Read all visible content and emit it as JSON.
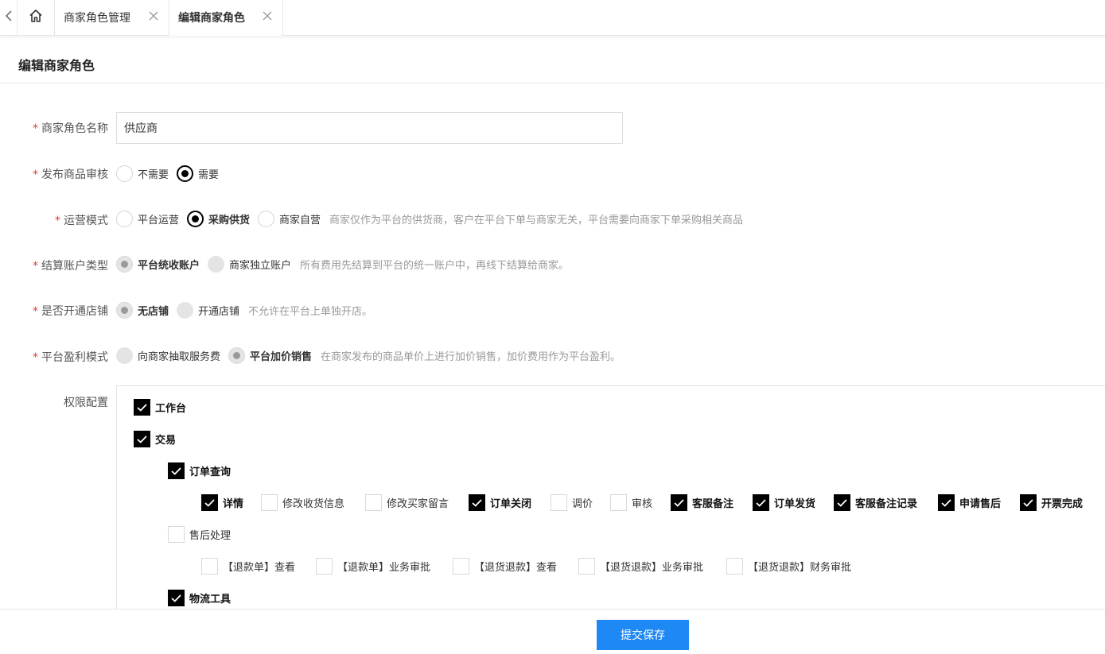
{
  "tabs": {
    "back_icon": "chevron-left-icon",
    "home_icon": "home-icon",
    "items": [
      {
        "label": "商家角色管理",
        "active": false
      },
      {
        "label": "编辑商家角色",
        "active": true
      }
    ]
  },
  "page": {
    "title": "编辑商家角色"
  },
  "form": {
    "role_name": {
      "label": "商家角色名称",
      "required": true,
      "value": "供应商"
    },
    "audit": {
      "label": "发布商品审核",
      "required": true,
      "options": [
        {
          "label": "不需要",
          "checked": false
        },
        {
          "label": "需要",
          "checked": true
        }
      ]
    },
    "operation_mode": {
      "label": "运营模式",
      "required": true,
      "options": [
        {
          "label": "平台运营",
          "checked": false
        },
        {
          "label": "采购供货",
          "checked": true
        },
        {
          "label": "商家自营",
          "checked": false
        }
      ],
      "hint": "商家仅作为平台的供货商，客户在平台下单与商家无关，平台需要向商家下单采购相关商品"
    },
    "account_type": {
      "label": "结算账户类型",
      "required": true,
      "options": [
        {
          "label": "平台统收账户",
          "checked": true
        },
        {
          "label": "商家独立账户",
          "checked": false
        }
      ],
      "hint": "所有费用先结算到平台的统一账户中，再线下结算给商家。"
    },
    "open_store": {
      "label": "是否开通店铺",
      "required": true,
      "options": [
        {
          "label": "无店铺",
          "checked": true
        },
        {
          "label": "开通店铺",
          "checked": false
        }
      ],
      "hint": "不允许在平台上单独开店。"
    },
    "profit_mode": {
      "label": "平台盈利模式",
      "required": true,
      "options": [
        {
          "label": "向商家抽取服务费",
          "checked": false
        },
        {
          "label": "平台加价销售",
          "checked": true
        }
      ],
      "hint": "在商家发布的商品单价上进行加价销售，加价费用作为平台盈利。"
    },
    "permissions": {
      "label": "权限配置",
      "workbench": {
        "label": "工作台",
        "checked": true
      },
      "trade": {
        "label": "交易",
        "checked": true
      },
      "order_query": {
        "label": "订单查询",
        "checked": true
      },
      "order_items": [
        {
          "label": "详情",
          "checked": true
        },
        {
          "label": "修改收货信息",
          "checked": false
        },
        {
          "label": "修改买家留言",
          "checked": false
        },
        {
          "label": "订单关闭",
          "checked": true
        },
        {
          "label": "调价",
          "checked": false
        },
        {
          "label": "审核",
          "checked": false
        },
        {
          "label": "客服备注",
          "checked": true
        },
        {
          "label": "订单发货",
          "checked": true
        },
        {
          "label": "客服备注记录",
          "checked": true
        },
        {
          "label": "申请售后",
          "checked": true
        },
        {
          "label": "开票完成",
          "checked": true
        }
      ],
      "after_sales": {
        "label": "售后处理",
        "checked": false
      },
      "after_sales_items": [
        {
          "label": "【退款单】查看",
          "checked": false
        },
        {
          "label": "【退款单】业务审批",
          "checked": false
        },
        {
          "label": "【退货退款】查看",
          "checked": false
        },
        {
          "label": "【退货退款】业务审批",
          "checked": false
        },
        {
          "label": "【退货退款】财务审批",
          "checked": false
        }
      ],
      "logistics": {
        "label": "物流工具",
        "checked": true
      }
    }
  },
  "footer": {
    "submit_label": "提交保存"
  }
}
